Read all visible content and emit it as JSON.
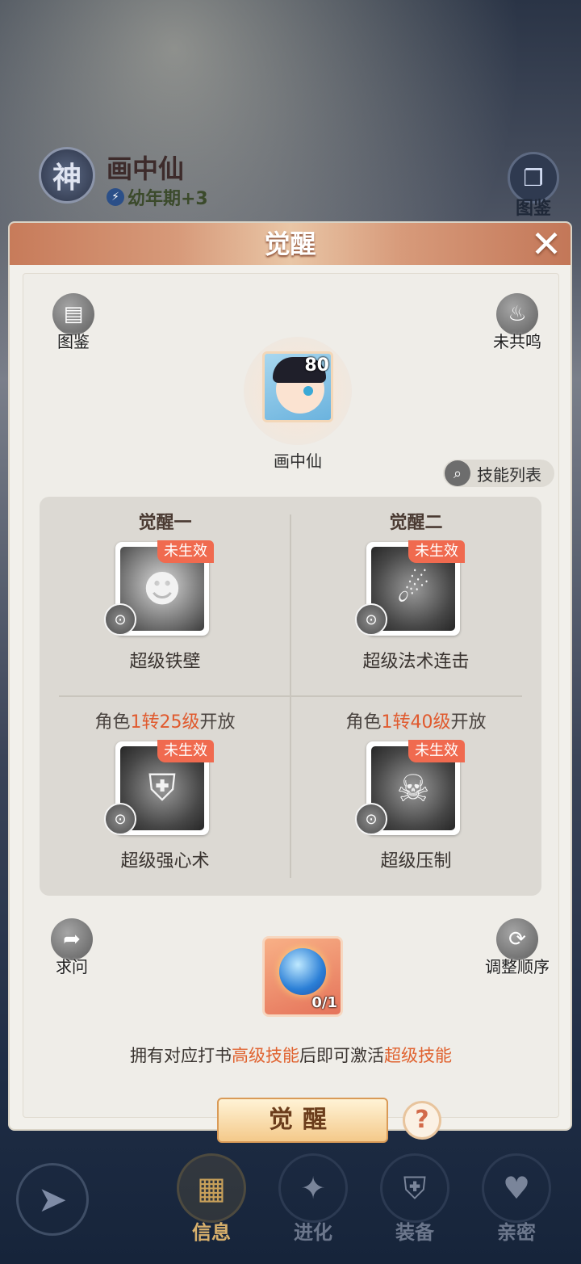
{
  "header": {
    "god_badge": "神",
    "hero_name": "画中仙",
    "stage_icon": "lightning-icon",
    "stage": "幼年期+3",
    "album_label": "图鉴"
  },
  "modal": {
    "title": "觉醒",
    "close_icon": "close-icon",
    "left_button_label": "图鉴",
    "right_button_label": "未共鸣",
    "avatar": {
      "level": "80",
      "name": "画中仙"
    },
    "skill_list_label": "技能列表",
    "skills": [
      {
        "head": "觉醒一",
        "tag": "未生效",
        "name": "超级铁壁"
      },
      {
        "head": "觉醒二",
        "tag": "未生效",
        "name": "超级法术连击"
      },
      {
        "req_prefix": "角色",
        "req_hl": "1转25级",
        "req_suffix": "开放",
        "tag": "未生效",
        "name": "超级强心术"
      },
      {
        "req_prefix": "角色",
        "req_hl": "1转40级",
        "req_suffix": "开放",
        "tag": "未生效",
        "name": "超级压制"
      }
    ],
    "ask_label": "求问",
    "reorder_label": "调整顺序",
    "item_count": "0/1",
    "hint": {
      "p1": "拥有对应打书",
      "hl1": "高级技能",
      "p2": "后即可激活",
      "hl2": "超级技能"
    },
    "awaken_button": "觉醒",
    "help_label": "?"
  },
  "nav": {
    "tabs": [
      {
        "label": "信息",
        "active": true
      },
      {
        "label": "进化",
        "active": false
      },
      {
        "label": "装备",
        "active": false
      },
      {
        "label": "亲密",
        "active": false
      }
    ]
  },
  "colors": {
    "accent": "#e05a2e",
    "tag": "#f06a4f",
    "header": "#d79a7a"
  }
}
